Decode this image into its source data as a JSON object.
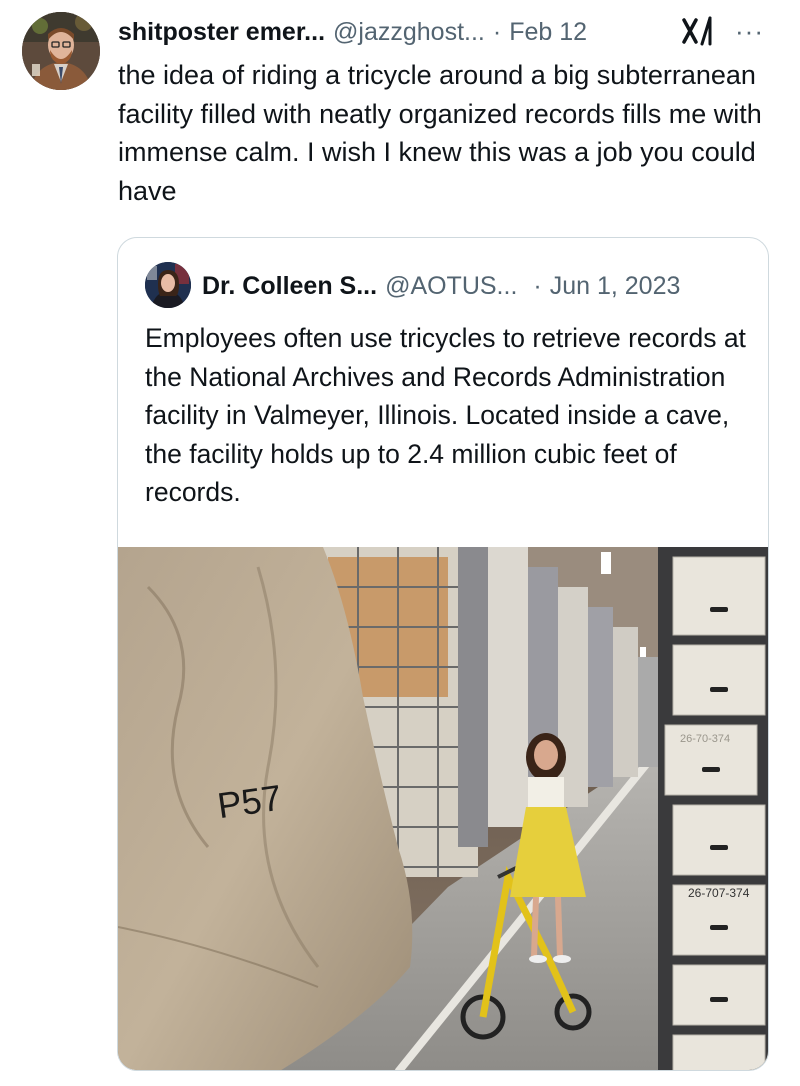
{
  "tweet": {
    "display_name": "shitposter emer...",
    "handle": "@jazzghost...",
    "separator": "·",
    "date": "Feb 12",
    "more_label": "···",
    "text": "the idea of riding a tricycle around a big subterranean facility filled with neatly organized records fills me with immense calm. I wish I knew this was a job you could have"
  },
  "quoted": {
    "display_name": "Dr. Colleen S...",
    "handle": "@AOTUS...",
    "separator": "·",
    "date": "Jun 1, 2023",
    "text": "Employees often use tricycles to retrieve records at the National Archives and Records Administration facility in Valmeyer, Illinois. Located inside a cave, the facility holds up to 2.4 million cubic feet of records."
  },
  "photo": {
    "wall_marking": "P57",
    "box_label": "26-707-374",
    "box_label_faint": "26-70-374"
  },
  "icons": {
    "grok": "grok-icon",
    "more": "more-options-icon"
  }
}
